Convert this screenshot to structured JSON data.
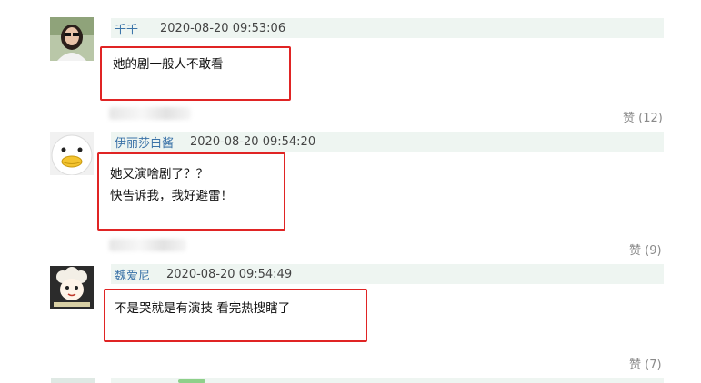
{
  "comments": [
    {
      "username": "千千",
      "timestamp": "2020-08-20 09:53:06",
      "lines": [
        "她的剧一般人不敢看"
      ],
      "likes": "赞 (12)",
      "avatar_icon": "woman-photo-avatar"
    },
    {
      "username": "伊丽莎白酱",
      "timestamp": "2020-08-20 09:54:20",
      "lines": [
        "她又演啥剧了？？",
        "快告诉我，我好避雷！"
      ],
      "likes": "赞 (9)",
      "avatar_icon": "duck-avatar"
    },
    {
      "username": "魏爱尼",
      "timestamp": "2020-08-20 09:54:49",
      "lines": [
        "不是哭就是有演技 看完热搜瞎了"
      ],
      "likes": "赞 (7)",
      "avatar_icon": "sheep-cartoon-avatar"
    }
  ],
  "colors": {
    "username": "#3b73a8",
    "meta_bg": "#eef5f1",
    "highlight_border": "#e02424",
    "likes": "#8a8a8a"
  }
}
